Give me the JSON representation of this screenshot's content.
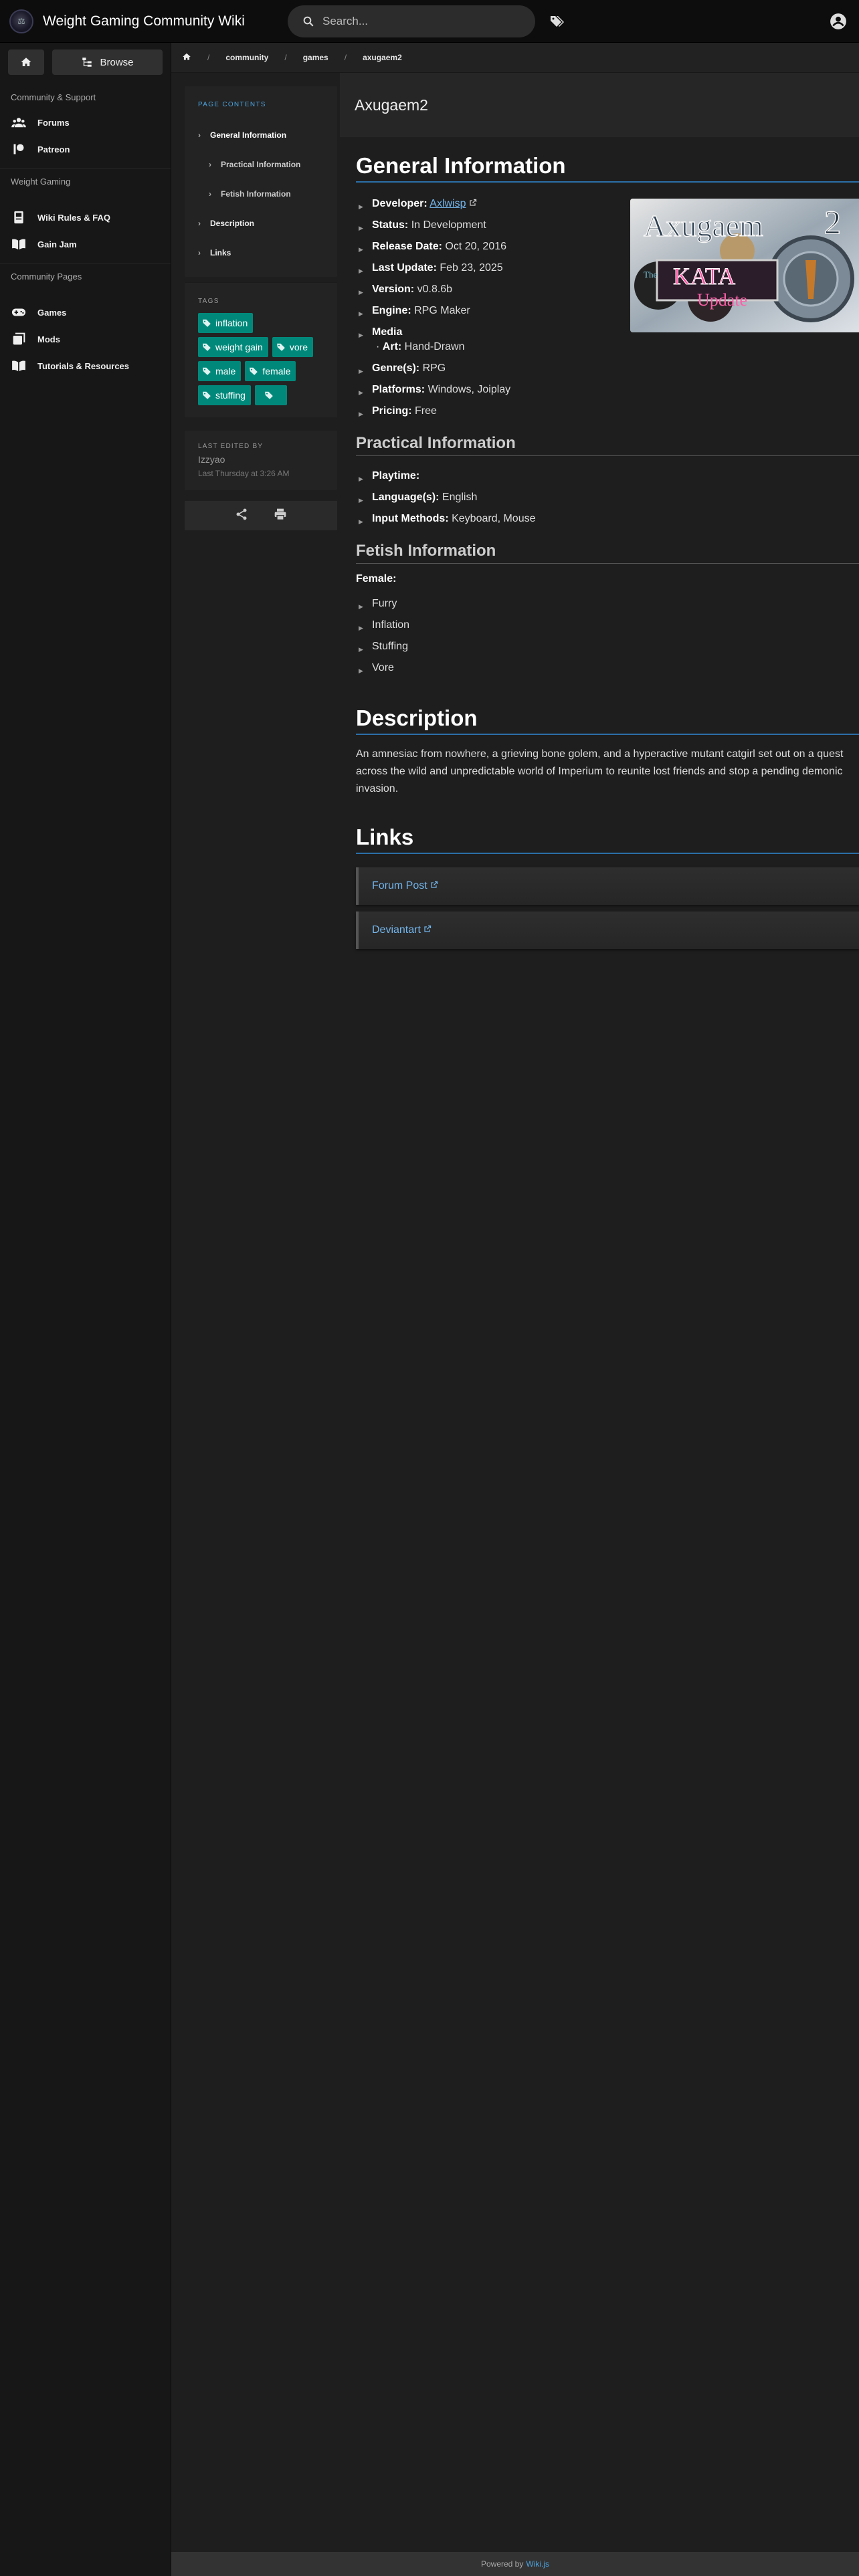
{
  "header": {
    "site_title": "Weight Gaming Community Wiki",
    "search_placeholder": "Search...",
    "tag_icon": "tags-icon",
    "account_icon": "account-circle-icon"
  },
  "sidebar": {
    "browse_label": "Browse",
    "sections": [
      {
        "header": "Community & Support",
        "items": [
          {
            "label": "Forums",
            "icon": "users-icon"
          },
          {
            "label": "Patreon",
            "icon": "patreon-icon"
          }
        ]
      },
      {
        "header": "Weight Gaming",
        "items": [
          {
            "label": "Wiki Rules & FAQ",
            "icon": "book-icon"
          },
          {
            "label": "Gain Jam",
            "icon": "book-open-icon"
          }
        ]
      },
      {
        "header": "Community Pages",
        "items": [
          {
            "label": "Games",
            "icon": "gamepad-icon"
          },
          {
            "label": "Mods",
            "icon": "mods-icon"
          },
          {
            "label": "Tutorials & Resources",
            "icon": "book-open-icon"
          }
        ]
      }
    ]
  },
  "breadcrumb": [
    "community",
    "games",
    "axugaem2"
  ],
  "toc": {
    "title": "PAGE CONTENTS",
    "items": [
      {
        "label": "General Information",
        "level": 1
      },
      {
        "label": "Practical Information",
        "level": 2
      },
      {
        "label": "Fetish Information",
        "level": 2
      },
      {
        "label": "Description",
        "level": 1
      },
      {
        "label": "Links",
        "level": 1
      }
    ]
  },
  "tags": {
    "title": "TAGS",
    "items": [
      "inflation",
      "weight gain",
      "vore",
      "male",
      "female",
      "stuffing",
      ""
    ]
  },
  "last_edited": {
    "title": "LAST EDITED BY",
    "user": "Izzyao",
    "when": "Last Thursday at 3:26 AM"
  },
  "page": {
    "title": "Axugaem2",
    "general": {
      "heading": "General Information",
      "developer_label": "Developer:",
      "developer_value": "Axlwisp",
      "status_label": "Status:",
      "status_value": "In Development",
      "release_label": "Release Date:",
      "release_value": "Oct 20, 2016",
      "update_label": "Last Update:",
      "update_value": "Feb 23, 2025",
      "version_label": "Version:",
      "version_value": "v0.8.6b",
      "engine_label": "Engine:",
      "engine_value": "RPG Maker",
      "media_label": "Media",
      "art_label": "Art:",
      "art_value": "Hand-Drawn",
      "genre_label": "Genre(s):",
      "genre_value": "RPG",
      "platforms_label": "Platforms:",
      "platforms_value": "Windows, Joiplay",
      "pricing_label": "Pricing:",
      "pricing_value": "Free"
    },
    "image": {
      "title_text": "Axugaem",
      "title_num": "2",
      "banner_small": "The",
      "banner_big": "KATA",
      "banner_sub": "Update"
    },
    "practical": {
      "heading": "Practical Information",
      "playtime_label": "Playtime:",
      "language_label": "Language(s):",
      "language_value": "English",
      "input_label": "Input Methods:",
      "input_value": "Keyboard, Mouse"
    },
    "fetish": {
      "heading": "Fetish Information",
      "female_label": "Female:",
      "items": [
        "Furry",
        "Inflation",
        "Stuffing",
        "Vore"
      ]
    },
    "description": {
      "heading": "Description",
      "text": "An amnesiac from nowhere, a grieving bone golem, and a hyperactive mutant catgirl set out on a quest across the wild and unpredictable world of Imperium to reunite lost friends and stop a pending demonic invasion."
    },
    "links": {
      "heading": "Links",
      "items": [
        "Forum Post",
        "Deviantart"
      ]
    }
  },
  "footer": {
    "powered_by": "Powered by",
    "engine": "Wiki.js"
  }
}
